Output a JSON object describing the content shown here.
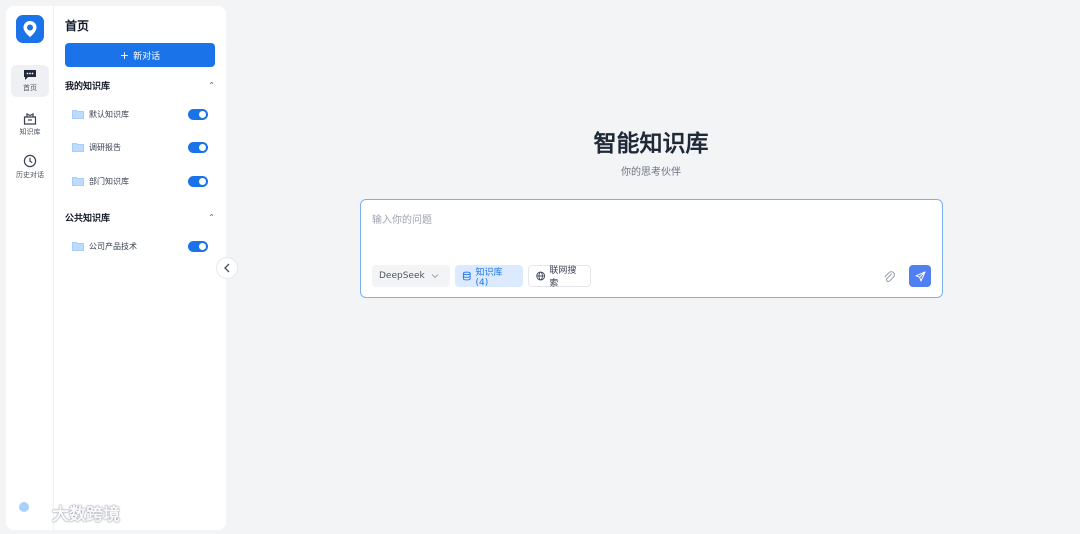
{
  "rail": {
    "items": [
      {
        "label": "首页",
        "icon": "chat-icon",
        "active": true
      },
      {
        "label": "知识库",
        "icon": "box-icon",
        "active": false
      },
      {
        "label": "历史对话",
        "icon": "clock-icon",
        "active": false
      }
    ]
  },
  "panel": {
    "title": "首页",
    "new_chat_label": "新对话",
    "my_kb": {
      "title": "我的知识库",
      "items": [
        {
          "name": "默认知识库",
          "enabled": true
        },
        {
          "name": "调研报告",
          "enabled": true
        },
        {
          "name": "部门知识库",
          "enabled": true
        }
      ]
    },
    "public_kb": {
      "title": "公共知识库",
      "items": [
        {
          "name": "公司产品技术",
          "enabled": true
        }
      ]
    }
  },
  "main": {
    "title": "智能知识库",
    "subtitle": "你的思考伙伴",
    "composer": {
      "placeholder": "输入你的问题",
      "value": "",
      "model": "DeepSeek",
      "kb_chip": "知识库 (4)",
      "web_chip": "联网搜索"
    }
  },
  "watermark": "大数跨境",
  "colors": {
    "accent": "#1a73e8",
    "send": "#4f7ff0",
    "chip_active_bg": "#dbeafe"
  }
}
